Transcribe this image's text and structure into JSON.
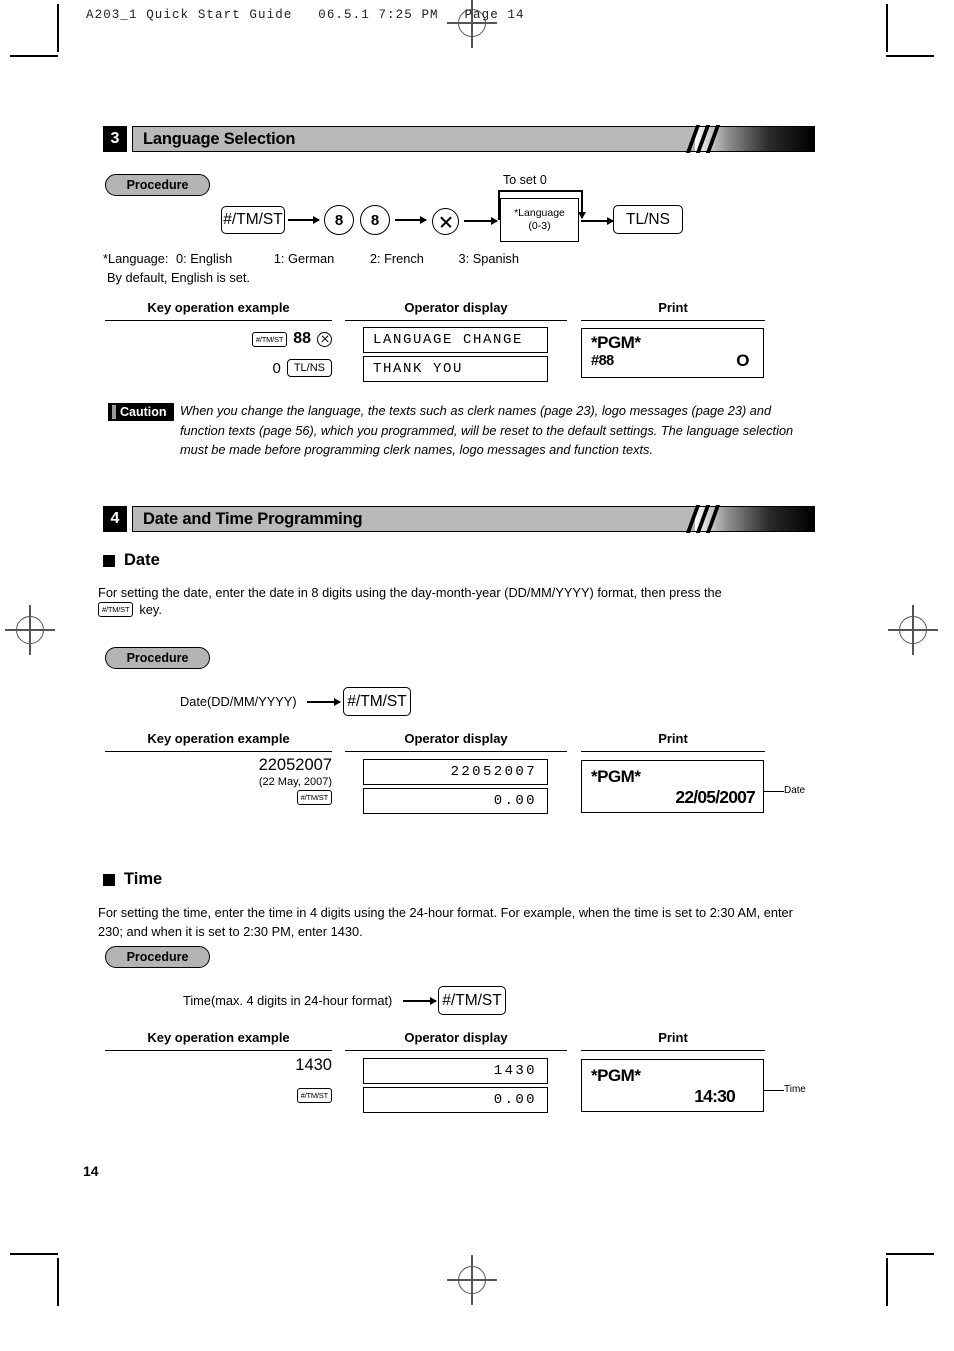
{
  "printer_slug": "A203_1 Quick Start Guide   06.5.1 7:25 PM   Page 14",
  "page_number": "14",
  "sections": [
    {
      "number": "3",
      "title": "Language Selection",
      "procedure_label": "Procedure",
      "flow": {
        "to_set_label": "To set  0",
        "key1": "#/TM/ST",
        "digit1": "8",
        "digit2": "8",
        "multiply_icon": "multiply-key-icon",
        "param_line1": "*Language",
        "param_line2": "(0-3)",
        "key_end": "TL/NS"
      },
      "footnote_line1_label": "*Language:",
      "footnote_options": [
        "0: English",
        "1: German",
        "2: French",
        "3: Spanish"
      ],
      "footnote_line2": "By default, English is set.",
      "table": {
        "headers": [
          "Key operation example",
          "Operator display",
          "Print"
        ],
        "keyops": [
          {
            "key": "#/TM/ST",
            "value": "88",
            "icon": "multiply-key-icon"
          },
          {
            "value": "0",
            "key": "TL/NS"
          }
        ],
        "displays": [
          "LANGUAGE CHANGE",
          "THANK YOU"
        ],
        "print": {
          "title": "*PGM*",
          "sub": "#88",
          "value": "O"
        }
      },
      "caution": {
        "tag": "Caution",
        "text": "When you change the language, the texts such as clerk names (page 23), logo messages (page 23) and function texts (page 56), which you programmed, will be reset to the default settings.  The language selection must be made before programming clerk names, logo messages and function texts."
      }
    },
    {
      "number": "4",
      "title": "Date and Time Programming",
      "date": {
        "heading": "Date",
        "description": "For setting the date, enter the date in 8 digits using the day-month-year (DD/MM/YYYY) format, then press the",
        "description_key": "#/TM/ST",
        "description_tail": "key.",
        "procedure_label": "Procedure",
        "flow_input": "Date(DD/MM/YYYY)",
        "flow_key": "#/TM/ST",
        "table": {
          "headers": [
            "Key operation example",
            "Operator display",
            "Print"
          ],
          "keyop_value": "22052007",
          "keyop_note": "(22 May, 2007)",
          "keyop_key": "#/TM/ST",
          "displays": [
            "22052007",
            "0.00"
          ],
          "print": {
            "title": "*PGM*",
            "value": "22/05/2007"
          },
          "callout": "Date"
        }
      },
      "time": {
        "heading": "Time",
        "description": "For setting the time, enter the time in 4 digits using the 24-hour format.  For example, when the time is set to 2:30 AM, enter 230; and when it is set to 2:30 PM, enter 1430.",
        "procedure_label": "Procedure",
        "flow_input": "Time(max. 4 digits in 24-hour format)",
        "flow_key": "#/TM/ST",
        "table": {
          "headers": [
            "Key operation example",
            "Operator display",
            "Print"
          ],
          "keyop_value": "1430",
          "keyop_key": "#/TM/ST",
          "displays": [
            "1430",
            "0.00"
          ],
          "print": {
            "title": "*PGM*",
            "value": "14:30"
          },
          "callout": "Time"
        }
      }
    }
  ]
}
